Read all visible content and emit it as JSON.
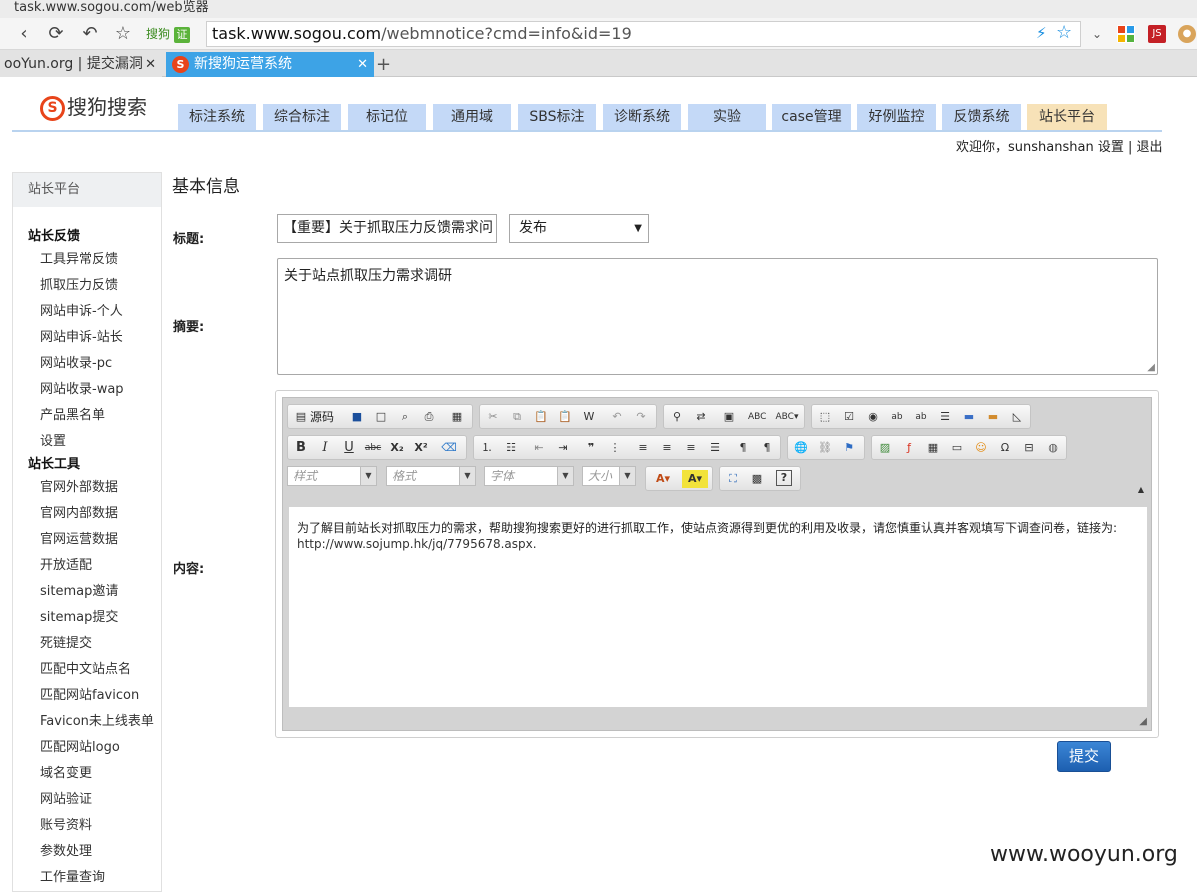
{
  "browser": {
    "window_title": "task.www.sogou.com/web览器",
    "url_host": "task.www.sogou.com",
    "url_path": "/webmnotice?cmd=info&id=19",
    "badge_label": "搜狗",
    "badge_mark": "证",
    "tabs": [
      {
        "label": "ooYun.org | 提交漏洞",
        "close": "✕"
      },
      {
        "label": "新搜狗运营系统",
        "close": "✕"
      }
    ],
    "ext_icons": [
      "apps-icon",
      "js-icon",
      "cookie-icon"
    ],
    "colors": {
      "active_tab": "#3da3e6",
      "url_icons": "#1a8fe0"
    }
  },
  "header": {
    "logo_text": "搜狗搜索",
    "logo_mark": "S",
    "nav_tabs": [
      "标注系统",
      "综合标注",
      "标记位",
      "通用域",
      "SBS标注",
      "诊断系统",
      "实验",
      "case管理",
      "好例监控",
      "反馈系统",
      "站长平台"
    ],
    "active_tab": "站长平台",
    "welcome": "欢迎你，",
    "username": "sunshanshan",
    "settings": "设置",
    "separator": "|",
    "logout": "退出",
    "colors": {
      "nav_tab": "#c4d9f7",
      "nav_tab_active": "#f7e2b8"
    }
  },
  "sidebar": {
    "heading": "站长平台",
    "groups": [
      {
        "title": "站长反馈",
        "items": [
          "工具异常反馈",
          "抓取压力反馈",
          "网站申诉-个人",
          "网站申诉-站长",
          "网站收录-pc",
          "网站收录-wap",
          "产品黑名单",
          "设置"
        ]
      },
      {
        "title": "站长工具",
        "items": [
          "官网外部数据",
          "官网内部数据",
          "官网运营数据",
          "开放适配",
          "sitemap邀请",
          "sitemap提交",
          "死链提交",
          "匹配中文站点名",
          "匹配网站favicon",
          "Favicon未上线表单",
          "匹配网站logo",
          "域名变更",
          "网站验证",
          "账号资料",
          "参数处理",
          "工作量查询"
        ]
      }
    ]
  },
  "form": {
    "section_title": "基本信息",
    "title_label": "标题:",
    "title_value": "【重要】关于抓取压力反馈需求问",
    "status_value": "发布",
    "summary_label": "摘要:",
    "summary_value": "关于站点抓取压力需求调研",
    "content_label": "内容:",
    "content_text": "为了解目前站长对抓取压力的需求，帮助搜狗搜索更好的进行抓取工作，使站点资源得到更优的利用及收录，请您慎重认真并客观填写下调查问卷，链接为:",
    "content_link": "http://www.sojump.hk/jq/7795678.aspx.",
    "submit_label": "提交",
    "colors": {
      "submit": "#1d5fb0"
    }
  },
  "editor": {
    "source_label": "源码",
    "combos": [
      "样式",
      "格式",
      "字体",
      "大小"
    ],
    "bold": "B",
    "italic": "I",
    "underline": "U",
    "strike": "abc",
    "subscript": "X₂",
    "superscript": "X²"
  },
  "watermark": "www.wooyun.org"
}
